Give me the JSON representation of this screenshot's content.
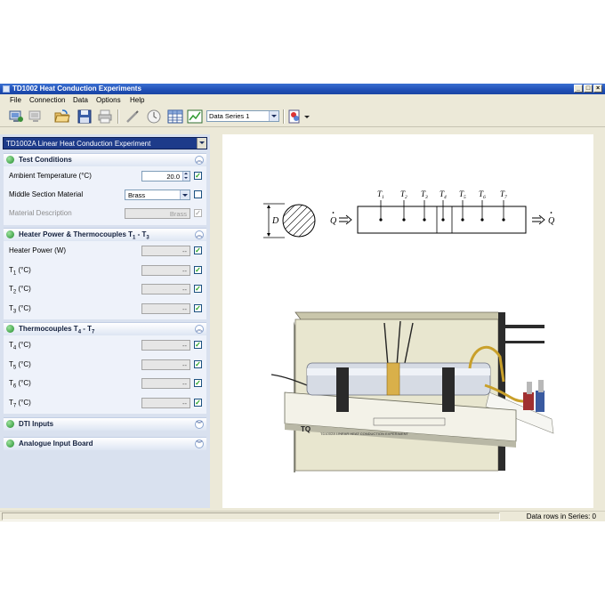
{
  "window": {
    "title": "TD1002 Heat Conduction Experiments",
    "controls": [
      "_",
      "□",
      "×"
    ]
  },
  "menu": [
    "File",
    "Connection",
    "Data",
    "Options",
    "Help"
  ],
  "toolbar": {
    "series_value": "Data Series 1"
  },
  "experiment_select": "TD1002A Linear Heat Conduction Experiment",
  "sections": {
    "test_conditions": {
      "title": "Test Conditions",
      "rows": [
        {
          "label": "Ambient Temperature  (°C)",
          "value": "20.0"
        },
        {
          "label": "Middle Section Material",
          "value": "Brass"
        },
        {
          "label": "Material Description",
          "value": "Brass"
        }
      ]
    },
    "heater": {
      "title": "Heater Power & Thermocouples T",
      "sub1": "1",
      "sep": " - T",
      "sub2": "3",
      "rows": [
        {
          "label": "Heater Power   (W)",
          "value": "--"
        },
        {
          "label": "T",
          "sub": "1",
          "unit": "  (°C)",
          "value": "--"
        },
        {
          "label": "T",
          "sub": "2",
          "unit": "  (°C)",
          "value": "--"
        },
        {
          "label": "T",
          "sub": "3",
          "unit": "  (°C)",
          "value": "--"
        }
      ]
    },
    "thermo": {
      "title": "Thermocouples T",
      "sub1": "4",
      "sep": " - T",
      "sub2": "7",
      "rows": [
        {
          "label": "T",
          "sub": "4",
          "unit": "  (°C)",
          "value": "--"
        },
        {
          "label": "T",
          "sub": "5",
          "unit": "  (°C)",
          "value": "--"
        },
        {
          "label": "T",
          "sub": "6",
          "unit": "  (°C)",
          "value": "--"
        },
        {
          "label": "T",
          "sub": "7",
          "unit": "  (°C)",
          "value": "--"
        }
      ]
    },
    "dti": {
      "title": "DTI Inputs"
    },
    "analogue": {
      "title": "Analogue Input Board"
    }
  },
  "diagram": {
    "t_labels": [
      "T",
      "T",
      "T",
      "T",
      "T",
      "T",
      "T"
    ],
    "t_subs": [
      "1",
      "2",
      "3",
      "4",
      "5",
      "6",
      "7"
    ],
    "diameter_label": "D",
    "q_label": "Q",
    "apparatus_text": "TD1002A LINEAR HEAT CONDUCTION EXPERIMENT",
    "logo": "TQ"
  },
  "status": {
    "text": "Data rows in Series: 0"
  },
  "colors": {
    "title_bar": "#1f4fb6",
    "panel_bg": "#d9e1ef",
    "brass": "#d9b04a",
    "tube": "#d6dbe4"
  }
}
